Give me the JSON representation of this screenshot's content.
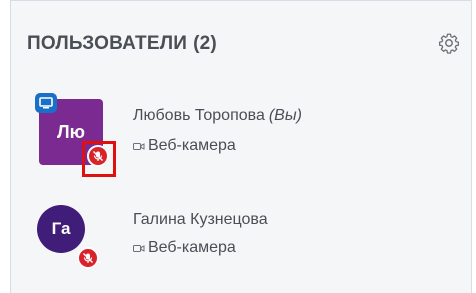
{
  "panel": {
    "title": "ПОЛЬЗОВАТЕЛИ",
    "count": "(2)",
    "settings_icon": "gear-icon"
  },
  "users": [
    {
      "initials": "Лю",
      "name": "Любовь Торопова",
      "you_label": "(Вы)",
      "device": "Веб-камера",
      "avatar_color": "#7b2a91",
      "presenter": true,
      "mic": "muted"
    },
    {
      "initials": "Га",
      "name": "Галина Кузнецова",
      "device": "Веб-камера",
      "avatar_color": "#3f1d78",
      "presenter": false,
      "mic": "muted"
    }
  ],
  "colors": {
    "muted_badge": "#d8232a",
    "presenter_badge": "#1870c9",
    "highlight": "#e01010"
  }
}
